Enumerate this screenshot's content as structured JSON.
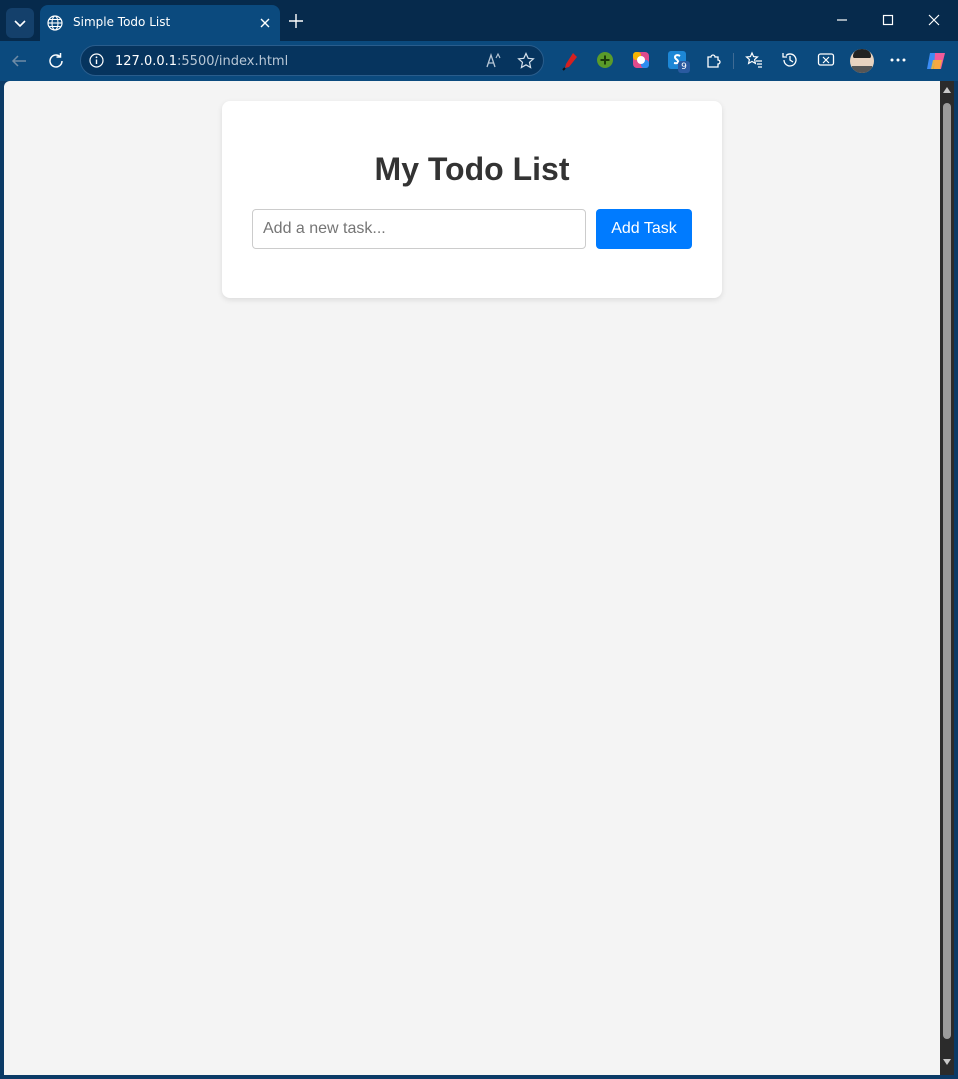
{
  "browser": {
    "tab": {
      "title": "Simple Todo List"
    },
    "address_bar": {
      "host": "127.0.0.1",
      "rest": ":5500/index.html"
    },
    "extension_badge": "9"
  },
  "page": {
    "title": "My Todo List",
    "input": {
      "placeholder": "Add a new task...",
      "value": ""
    },
    "add_button_label": "Add Task"
  },
  "colors": {
    "accent": "#007bff",
    "page_background": "#f4f4f4",
    "card_background": "#ffffff",
    "title_text": "#333333"
  }
}
